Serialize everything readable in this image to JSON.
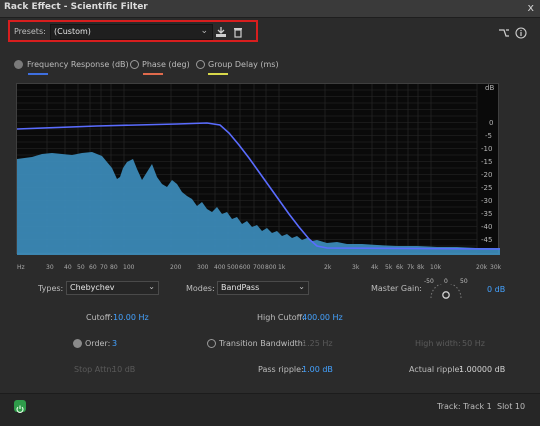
{
  "window": {
    "title": "Rack Effect - Scientific Filter",
    "close_glyph": "x"
  },
  "presets": {
    "label": "Presets:",
    "value": "(Custom)"
  },
  "legend": [
    {
      "label": "Frequency Response (dB)",
      "color": "#3e6fe0"
    },
    {
      "label": "Phase (deg)",
      "color": "#e06a4c"
    },
    {
      "label": "Group Delay (ms)",
      "color": "#d8d84a"
    }
  ],
  "graph": {
    "y_labels": [
      "dB",
      "0",
      "-5",
      "-10",
      "-15",
      "-20",
      "-25",
      "-30",
      "-35",
      "-40",
      "-45"
    ],
    "x_labels": [
      "Hz",
      "30",
      "40",
      "50",
      "60",
      "70",
      "80",
      "100",
      "200",
      "300",
      "400",
      "500",
      "600",
      "700",
      "800",
      "1k",
      "2k",
      "3k",
      "4k",
      "5k",
      "6k",
      "7k",
      "8k",
      "10k",
      "20k",
      "30k"
    ]
  },
  "controls": {
    "types_label": "Types:",
    "types_value": "Chebychev",
    "modes_label": "Modes:",
    "modes_value": "BandPass",
    "master_gain_label": "Master Gain:",
    "gain_min": "-50",
    "gain_zero": "0",
    "gain_max": "50",
    "gain_value": "0 dB",
    "cutoff_label": "Cutoff:",
    "cutoff_value": "10.00 Hz",
    "high_cutoff_label": "High Cutoff:",
    "high_cutoff_value": "400.00 Hz",
    "order_label": "Order:",
    "order_value": "3",
    "transition_label": "Transition Bandwidth:",
    "transition_value": "1.25 Hz",
    "high_width_label": "High width:",
    "high_width_value": "50 Hz",
    "stop_atten_label": "Stop Attn:",
    "stop_atten_value": "10 dB",
    "pass_ripple_label": "Pass ripple:",
    "pass_ripple_value": "1.00 dB",
    "actual_ripple_label": "Actual ripple:",
    "actual_ripple_value": "1.00000 dB"
  },
  "status": {
    "track": "Track: Track 1",
    "slot": "Slot 10"
  }
}
